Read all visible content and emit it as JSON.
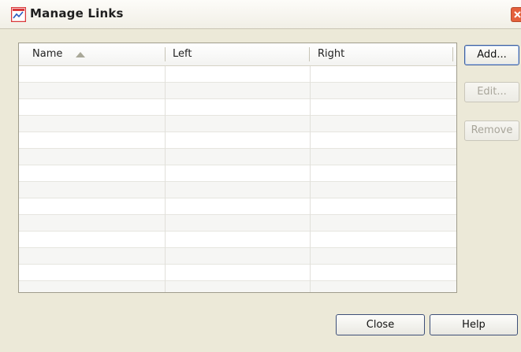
{
  "window": {
    "title": "Manage Links",
    "icon": "chart-app-icon",
    "close_icon": "close-icon"
  },
  "table": {
    "columns": [
      {
        "label": "Name",
        "sorted": "ascending"
      },
      {
        "label": "Left"
      },
      {
        "label": "Right"
      }
    ],
    "rows": []
  },
  "side_buttons": {
    "add": "Add...",
    "edit": "Edit...",
    "remove": "Remove"
  },
  "footer": {
    "close": "Close",
    "help": "Help"
  },
  "colors": {
    "window_bg": "#ece9d8",
    "close_button": "#e4603c",
    "icon_accent": "#d9383a"
  }
}
